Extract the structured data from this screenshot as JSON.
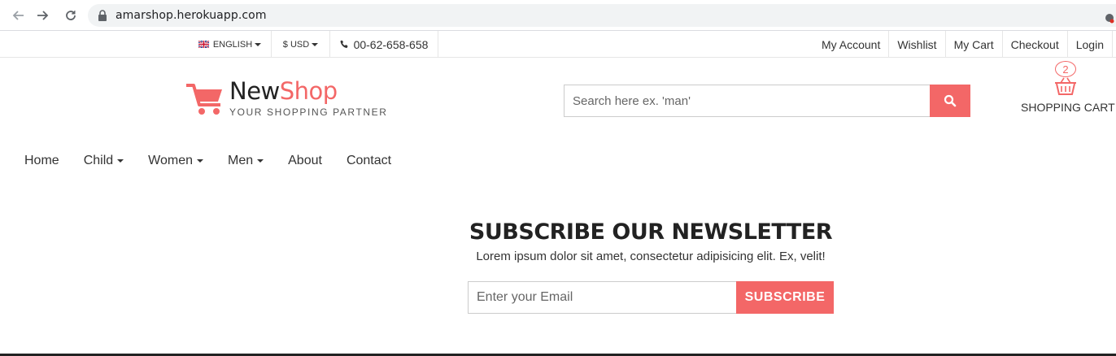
{
  "browser": {
    "url": "amarshop.herokuapp.com"
  },
  "topbar": {
    "language": "ENGLISH",
    "currency": "$ USD",
    "phone": "00-62-658-658",
    "links": [
      "My Account",
      "Wishlist",
      "My Cart",
      "Checkout",
      "Login"
    ]
  },
  "header": {
    "logo_new": "New",
    "logo_shop": "Shop",
    "tagline": "YOUR SHOPPING PARTNER",
    "search_placeholder": "Search here ex. 'man'",
    "cart_count": "2",
    "cart_label": "SHOPPING CART"
  },
  "nav": {
    "items": [
      "Home",
      "Child",
      "Women",
      "Men",
      "About",
      "Contact"
    ]
  },
  "newsletter": {
    "title": "SUBSCRIBE OUR NEWSLETTER",
    "description": "Lorem ipsum dolor sit amet, consectetur adipisicing elit. Ex, velit!",
    "email_placeholder": "Enter your Email",
    "button_label": "SUBSCRIBE"
  },
  "colors": {
    "accent": "#f36767",
    "text": "#333333"
  },
  "icons": [
    "arrow-back-icon",
    "arrow-forward-icon",
    "reload-icon",
    "lock-icon",
    "flag-uk-icon",
    "phone-icon",
    "cart-logo-icon",
    "search-icon",
    "basket-icon"
  ]
}
